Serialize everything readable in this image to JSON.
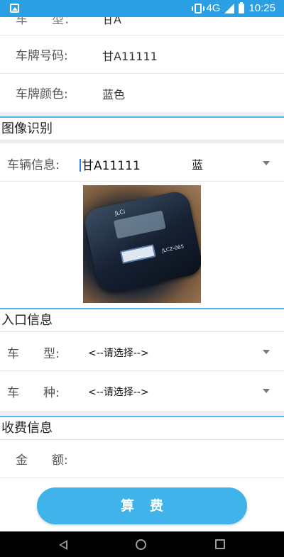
{
  "status_bar": {
    "network": "4G",
    "network_small": "4G",
    "time": "10:25"
  },
  "vehicle": {
    "type_label_partial": "车　　型：",
    "type_value_partial": "甘A",
    "plate_number_label": "车牌号码:",
    "plate_number_value": "甘A11111",
    "plate_color_label": "车牌颜色:",
    "plate_color_value": "蓝色"
  },
  "image_recognition": {
    "title": "图像识别",
    "vehicle_info_label": "车辆信息:",
    "plate_value": "甘A11111",
    "color_value": "蓝",
    "photo_brand": "JLCi",
    "photo_model": "JLCZ-065"
  },
  "entry_info": {
    "title": "入口信息",
    "vehicle_type_label": "车　　型:",
    "vehicle_type_value": "<--请选择-->",
    "vehicle_kind_label": "车　　种:",
    "vehicle_kind_value": "<--请选择-->"
  },
  "fee_info": {
    "title": "收费信息",
    "amount_label": "金　　额:"
  },
  "actions": {
    "calculate_label": "算费"
  }
}
